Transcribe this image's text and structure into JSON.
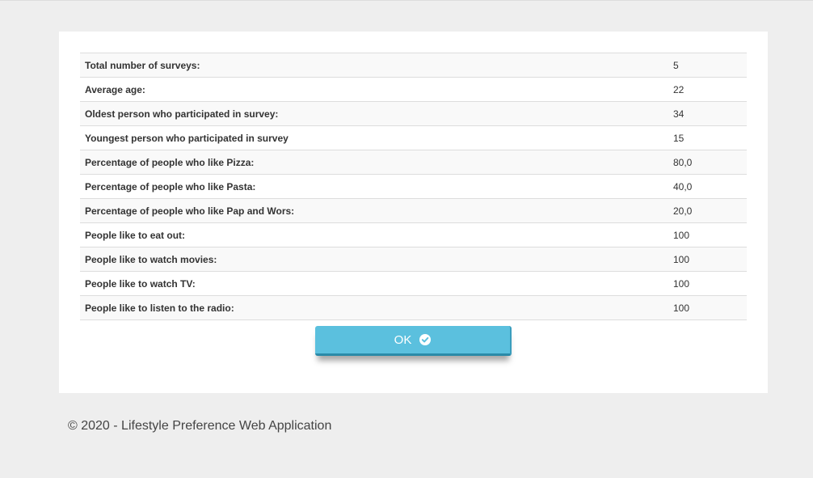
{
  "results": {
    "rows": [
      {
        "label": "Total number of surveys:",
        "value": "5"
      },
      {
        "label": "Average age:",
        "value": "22"
      },
      {
        "label": "Oldest person who participated in survey:",
        "value": "34"
      },
      {
        "label": "Youngest person who participated in survey",
        "value": "15"
      },
      {
        "label": "Percentage of people who like Pizza:",
        "value": "80,0"
      },
      {
        "label": "Percentage of people who like Pasta:",
        "value": "40,0"
      },
      {
        "label": "Percentage of people who like Pap and Wors:",
        "value": "20,0"
      },
      {
        "label": "People like to eat out:",
        "value": "100"
      },
      {
        "label": "People like to watch movies:",
        "value": "100"
      },
      {
        "label": "People like to watch TV:",
        "value": "100"
      },
      {
        "label": "People like to listen to the radio:",
        "value": "100"
      }
    ]
  },
  "ok_button": {
    "label": "OK",
    "icon": "check-circle-icon",
    "color": "#5bc0de"
  },
  "footer": {
    "text": "© 2020 - Lifestyle Preference Web Application"
  }
}
